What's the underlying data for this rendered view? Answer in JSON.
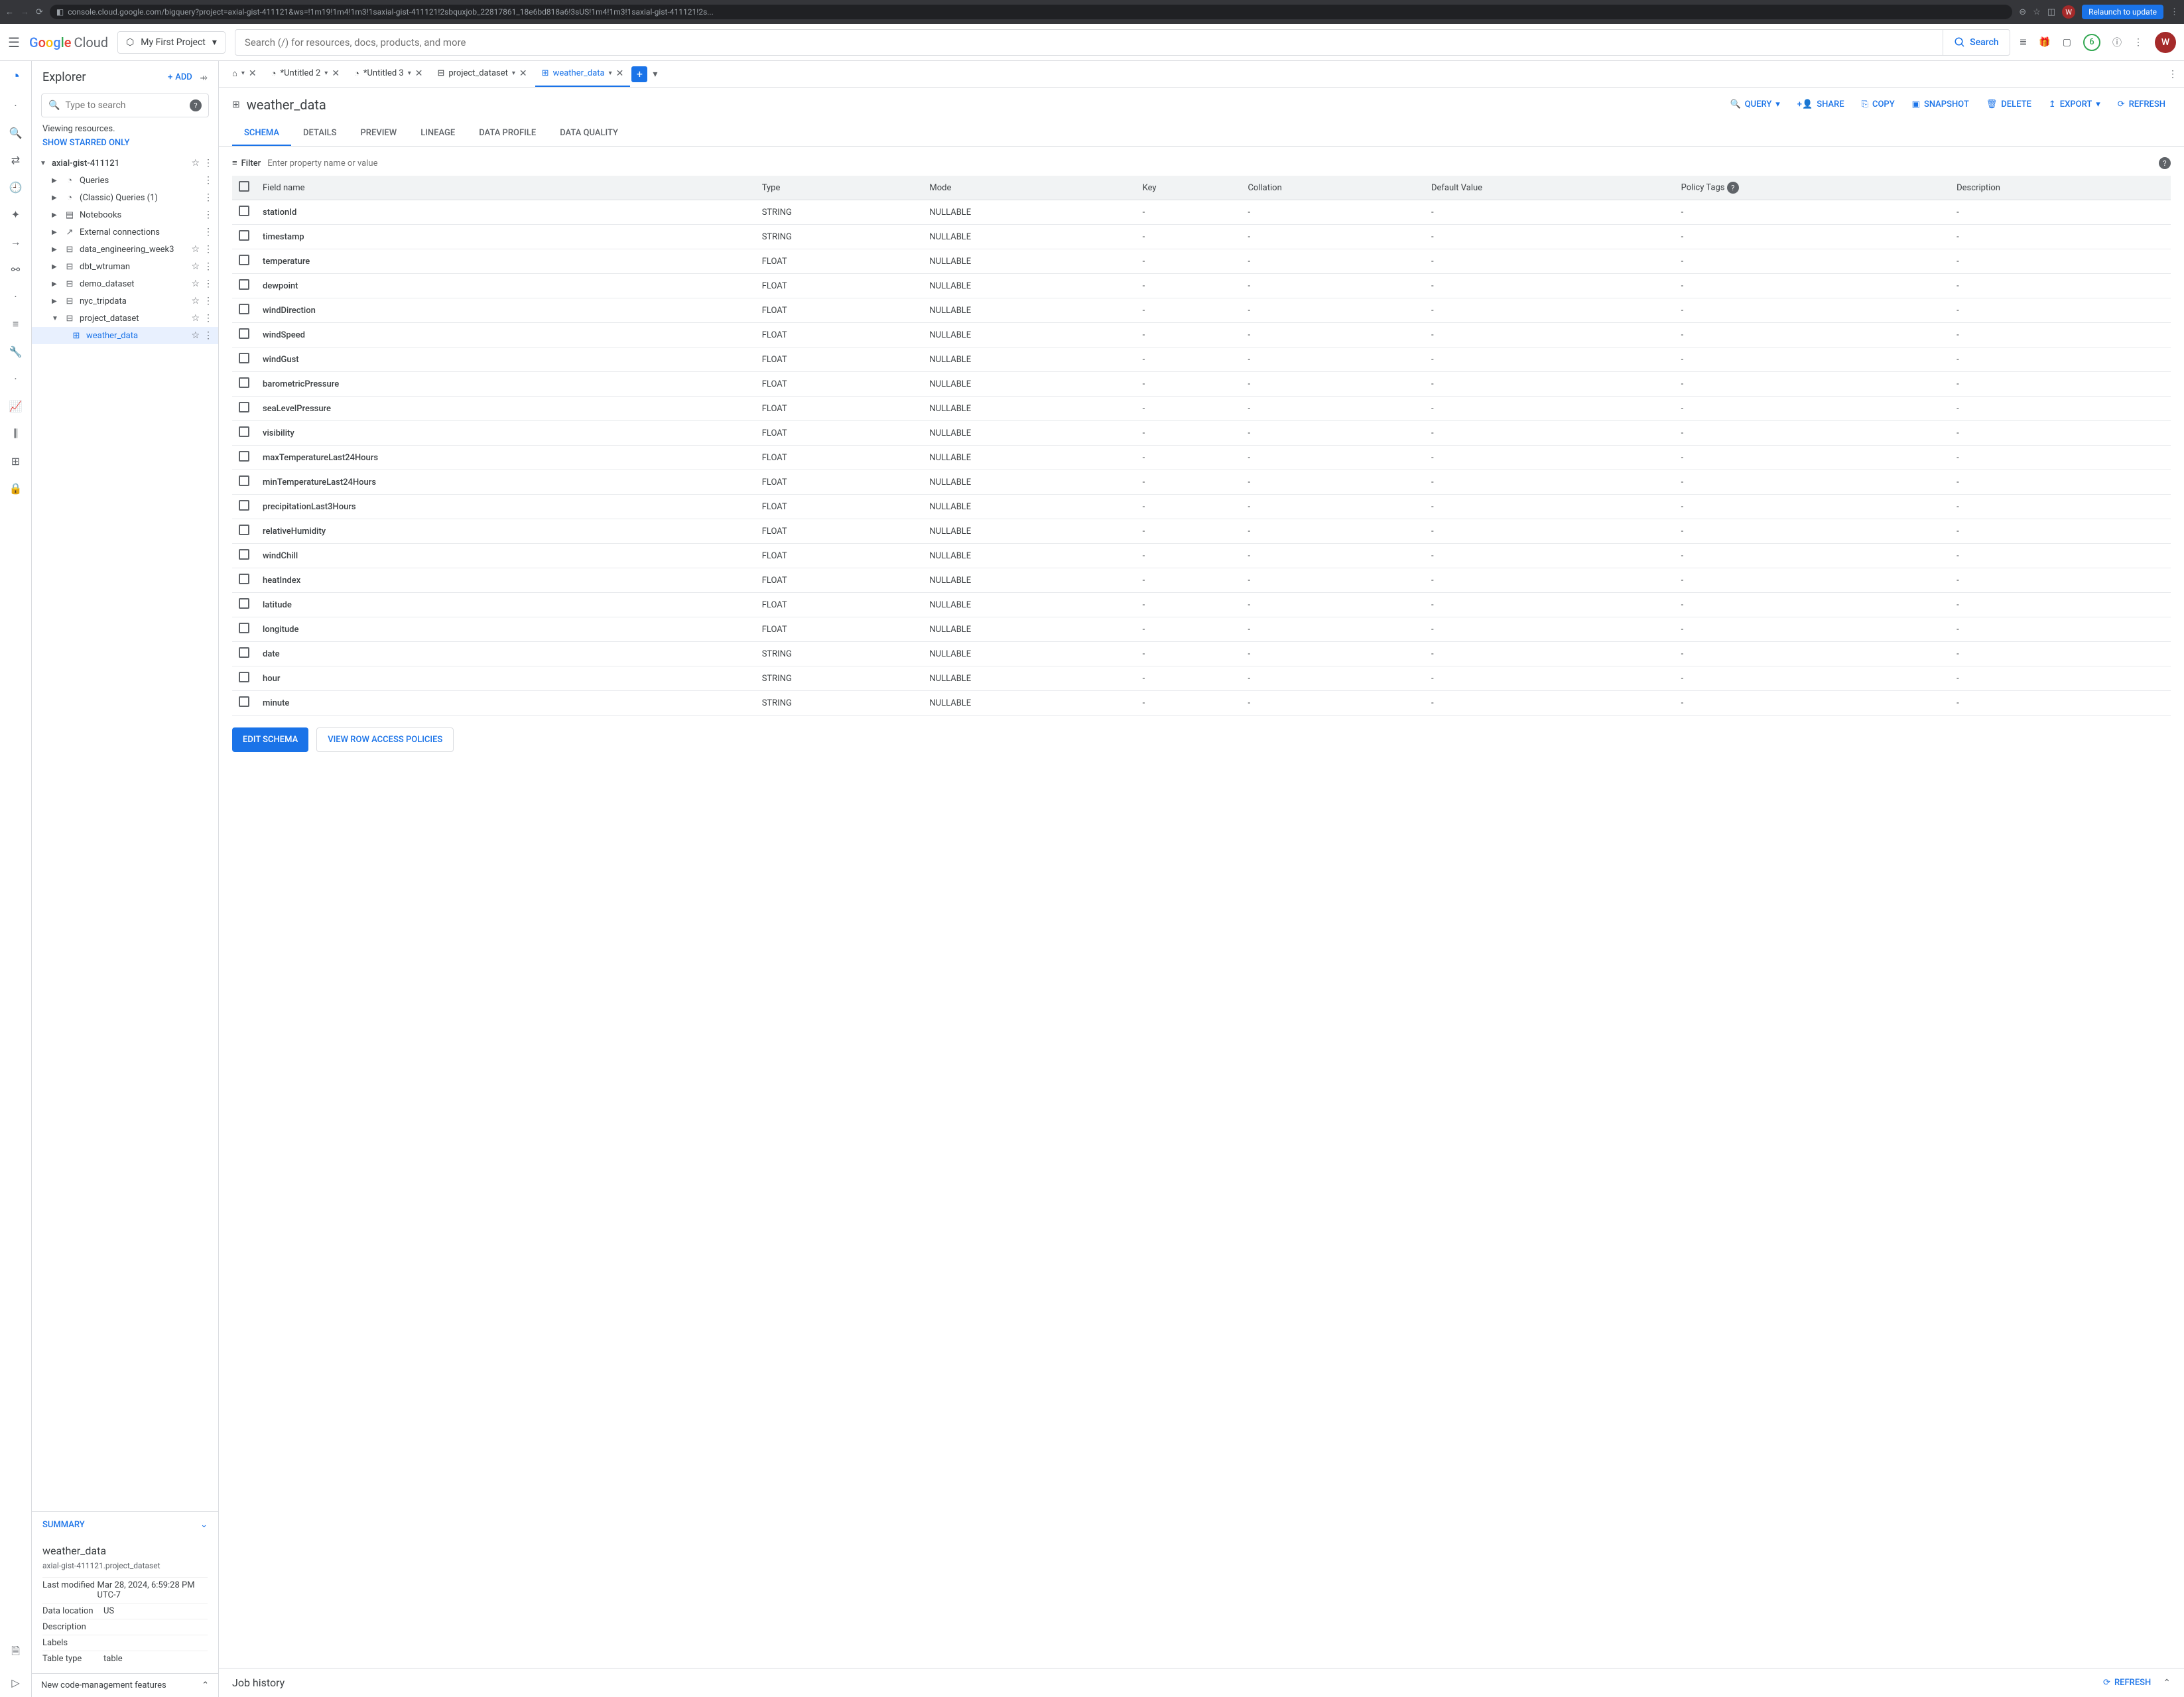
{
  "browser": {
    "url": "console.cloud.google.com/bigquery?project=axial-gist-411121&ws=!1m19!1m4!1m3!1saxial-gist-411121!2sbquxjob_22817861_18e6bd818a6!3sUS!1m4!1m3!1saxial-gist-411121!2s...",
    "relaunch": "Relaunch to update",
    "avatar_letter": "W"
  },
  "topbar": {
    "logo_cloud": "Cloud",
    "project": "My First Project",
    "search_placeholder": "Search (/) for resources, docs, products, and more",
    "search_label": "Search",
    "trial": "6",
    "avatar_letter": "W"
  },
  "explorer": {
    "title": "Explorer",
    "add": "ADD",
    "search_placeholder": "Type to search",
    "viewing": "Viewing resources.",
    "show_starred": "SHOW STARRED ONLY",
    "project": "axial-gist-411121",
    "nodes": {
      "queries": "Queries",
      "classic_queries": "(Classic) Queries (1)",
      "notebooks": "Notebooks",
      "external": "External connections",
      "de_week3": "data_engineering_week3",
      "dbt": "dbt_wtruman",
      "demo": "demo_dataset",
      "nyc": "nyc_tripdata",
      "project_dataset": "project_dataset",
      "weather_data": "weather_data"
    }
  },
  "summary": {
    "title": "SUMMARY",
    "name": "weather_data",
    "path": "axial-gist-411121.project_dataset",
    "last_modified_k": "Last modified",
    "last_modified_v": "Mar 28, 2024, 6:59:28 PM UTC-7",
    "data_location_k": "Data location",
    "data_location_v": "US",
    "description_k": "Description",
    "description_v": "",
    "labels_k": "Labels",
    "labels_v": "",
    "table_type_k": "Table type",
    "table_type_v": "table"
  },
  "footer": "New code-management features",
  "tabs": {
    "untitled2": "*Untitled 2",
    "untitled3": "*Untitled 3",
    "project_dataset": "project_dataset",
    "weather_data": "weather_data"
  },
  "table": {
    "name": "weather_data",
    "actions": {
      "query": "QUERY",
      "share": "SHARE",
      "copy": "COPY",
      "snapshot": "SNAPSHOT",
      "delete": "DELETE",
      "export": "EXPORT",
      "refresh": "REFRESH"
    },
    "subtabs": {
      "schema": "SCHEMA",
      "details": "DETAILS",
      "preview": "PREVIEW",
      "lineage": "LINEAGE",
      "data_profile": "DATA PROFILE",
      "data_quality": "DATA QUALITY"
    },
    "filter_label": "Filter",
    "filter_placeholder": "Enter property name or value",
    "columns": {
      "field_name": "Field name",
      "type": "Type",
      "mode": "Mode",
      "key": "Key",
      "collation": "Collation",
      "default_value": "Default Value",
      "policy_tags": "Policy Tags",
      "description": "Description"
    },
    "edit_schema": "EDIT SCHEMA",
    "view_policies": "VIEW ROW ACCESS POLICIES"
  },
  "schema_rows": [
    {
      "name": "stationId",
      "type": "STRING",
      "mode": "NULLABLE"
    },
    {
      "name": "timestamp",
      "type": "STRING",
      "mode": "NULLABLE"
    },
    {
      "name": "temperature",
      "type": "FLOAT",
      "mode": "NULLABLE"
    },
    {
      "name": "dewpoint",
      "type": "FLOAT",
      "mode": "NULLABLE"
    },
    {
      "name": "windDirection",
      "type": "FLOAT",
      "mode": "NULLABLE"
    },
    {
      "name": "windSpeed",
      "type": "FLOAT",
      "mode": "NULLABLE"
    },
    {
      "name": "windGust",
      "type": "FLOAT",
      "mode": "NULLABLE"
    },
    {
      "name": "barometricPressure",
      "type": "FLOAT",
      "mode": "NULLABLE"
    },
    {
      "name": "seaLevelPressure",
      "type": "FLOAT",
      "mode": "NULLABLE"
    },
    {
      "name": "visibility",
      "type": "FLOAT",
      "mode": "NULLABLE"
    },
    {
      "name": "maxTemperatureLast24Hours",
      "type": "FLOAT",
      "mode": "NULLABLE"
    },
    {
      "name": "minTemperatureLast24Hours",
      "type": "FLOAT",
      "mode": "NULLABLE"
    },
    {
      "name": "precipitationLast3Hours",
      "type": "FLOAT",
      "mode": "NULLABLE"
    },
    {
      "name": "relativeHumidity",
      "type": "FLOAT",
      "mode": "NULLABLE"
    },
    {
      "name": "windChill",
      "type": "FLOAT",
      "mode": "NULLABLE"
    },
    {
      "name": "heatIndex",
      "type": "FLOAT",
      "mode": "NULLABLE"
    },
    {
      "name": "latitude",
      "type": "FLOAT",
      "mode": "NULLABLE"
    },
    {
      "name": "longitude",
      "type": "FLOAT",
      "mode": "NULLABLE"
    },
    {
      "name": "date",
      "type": "STRING",
      "mode": "NULLABLE"
    },
    {
      "name": "hour",
      "type": "STRING",
      "mode": "NULLABLE"
    },
    {
      "name": "minute",
      "type": "STRING",
      "mode": "NULLABLE"
    }
  ],
  "job_history": {
    "title": "Job history",
    "refresh": "REFRESH"
  }
}
